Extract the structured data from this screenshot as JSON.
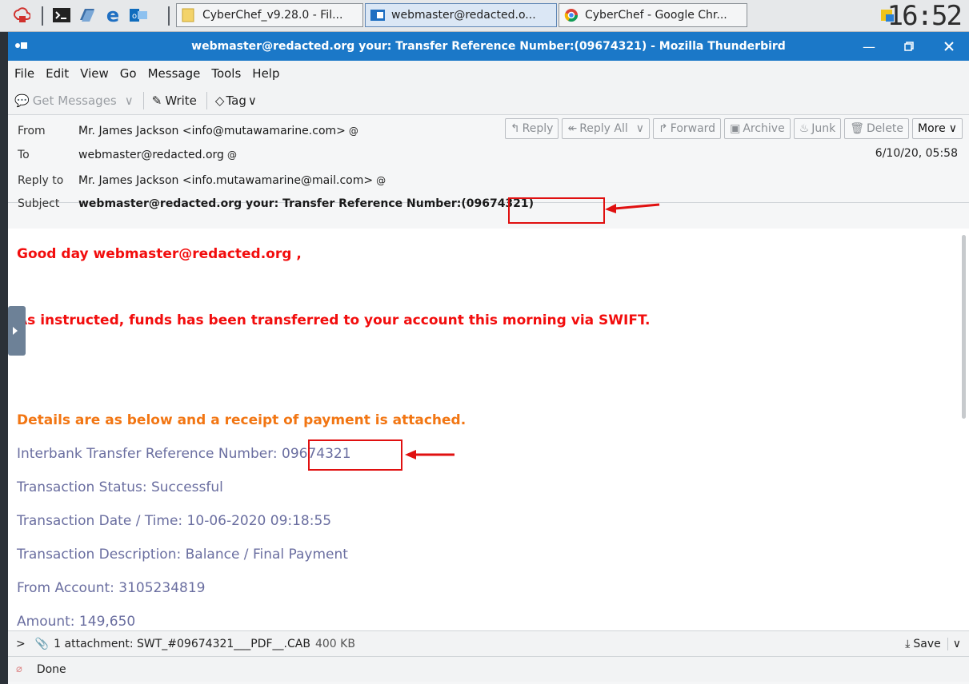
{
  "taskbar": {
    "tasks": [
      {
        "label": "CyberChef_v9.28.0 - Fil...",
        "icon": "folder-icon"
      },
      {
        "label": "webmaster@redacted.o...",
        "icon": "thunderbird-icon"
      },
      {
        "label": "CyberChef - Google Chr...",
        "icon": "chrome-icon"
      }
    ],
    "clock": "16:52"
  },
  "window": {
    "title": "webmaster@redacted.org your: Transfer Reference Number:(09674321) - Mozilla Thunderbird"
  },
  "menu": [
    "File",
    "Edit",
    "View",
    "Go",
    "Message",
    "Tools",
    "Help"
  ],
  "toolbar": {
    "get_messages": "Get Messages",
    "write": "Write",
    "tag": "Tag"
  },
  "header": {
    "from_label": "From",
    "from_value": "Mr. James Jackson <info@mutawamarine.com>",
    "to_label": "To",
    "to_value": "webmaster@redacted.org",
    "reply_to_label": "Reply to",
    "reply_to_value": "Mr. James Jackson <info.mutawamarine@mail.com>",
    "subject_label": "Subject",
    "subject_value": "webmaster@redacted.org your: Transfer Reference Number:(09674321)",
    "date": "6/10/20, 05:58",
    "buttons": {
      "reply": "Reply",
      "reply_all": "Reply All",
      "forward": "Forward",
      "archive": "Archive",
      "junk": "Junk",
      "delete": "Delete",
      "more": "More"
    }
  },
  "body": {
    "greeting": "Good day webmaster@redacted.org ,",
    "instructed": "As instructed, funds has been transferred to your account this morning via SWIFT.",
    "details_heading": "Details are as below and a receipt of payment is attached.",
    "ref_label": "Interbank Transfer Reference Number: ",
    "ref_value": "09674321",
    "status": "Transaction Status: Successful",
    "datetime": "Transaction Date / Time: 10-06-2020 09:18:55",
    "description": "Transaction Description: Balance / Final Payment",
    "from_account": "From Account: 3105234819",
    "amount": "Amount: 149,650"
  },
  "attachment": {
    "summary": "1 attachment: SWT_#09674321___PDF__.CAB",
    "size": "400 KB",
    "save": "Save"
  },
  "status": {
    "text": "Done"
  },
  "colors": {
    "titlebar": "#1b78c8",
    "red_text": "#f20d0d",
    "orange_text": "#f27613",
    "purple_text": "#6a6ea0",
    "highlight_box": "#e01010"
  }
}
